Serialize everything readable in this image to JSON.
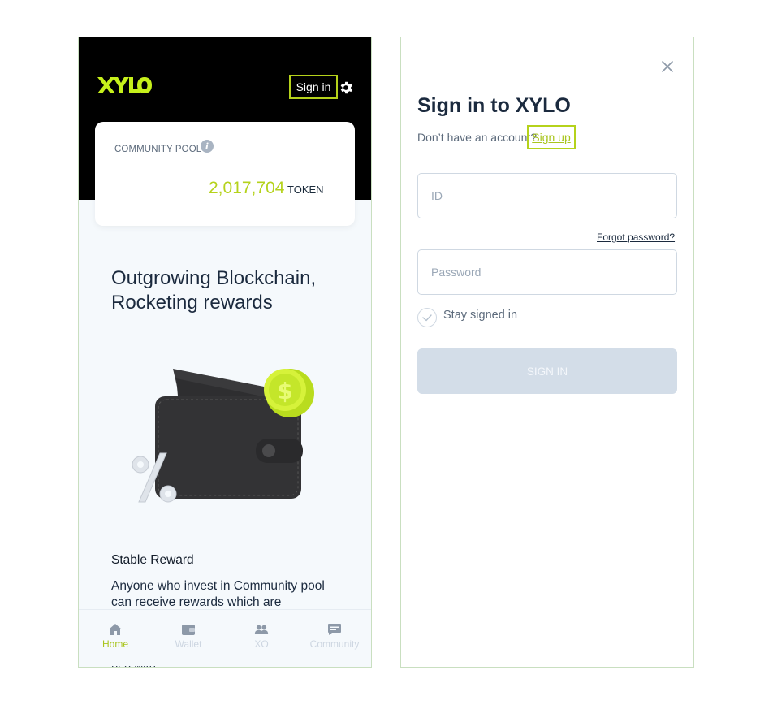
{
  "home": {
    "logo_text": "XYLO",
    "signin_label": "Sign in",
    "pool": {
      "label": "COMMUNITY POOL",
      "info_glyph": "i",
      "value": "2,017,704",
      "unit": "TOKEN"
    },
    "headline_line1": "Outgrowing Blockchain,",
    "headline_line2": "Rocketing rewards",
    "reward_title": "Stable Reward",
    "reward_desc": "Anyone who invest in Community pool can receive rewards which are",
    "reward_cut": "rich with",
    "tabs": [
      {
        "label": "Home",
        "icon": "home-icon",
        "active": true
      },
      {
        "label": "Wallet",
        "icon": "wallet-icon",
        "active": false
      },
      {
        "label": "XO",
        "icon": "users-icon",
        "active": false
      },
      {
        "label": "Community",
        "icon": "chat-icon",
        "active": false
      }
    ]
  },
  "signin": {
    "title": "Sign in to XYLO",
    "no_account": "Don’t have an account?",
    "signup_label": "Sign up",
    "id_placeholder": "ID",
    "forgot_label": "Forgot password?",
    "password_placeholder": "Password",
    "stay_label": "Stay signed in",
    "button_label": "SIGN IN"
  },
  "colors": {
    "accent": "#b5d21b",
    "dark": "#1b2a3e",
    "muted": "#5d6b7c",
    "disabled_button": "#d3dde8"
  }
}
